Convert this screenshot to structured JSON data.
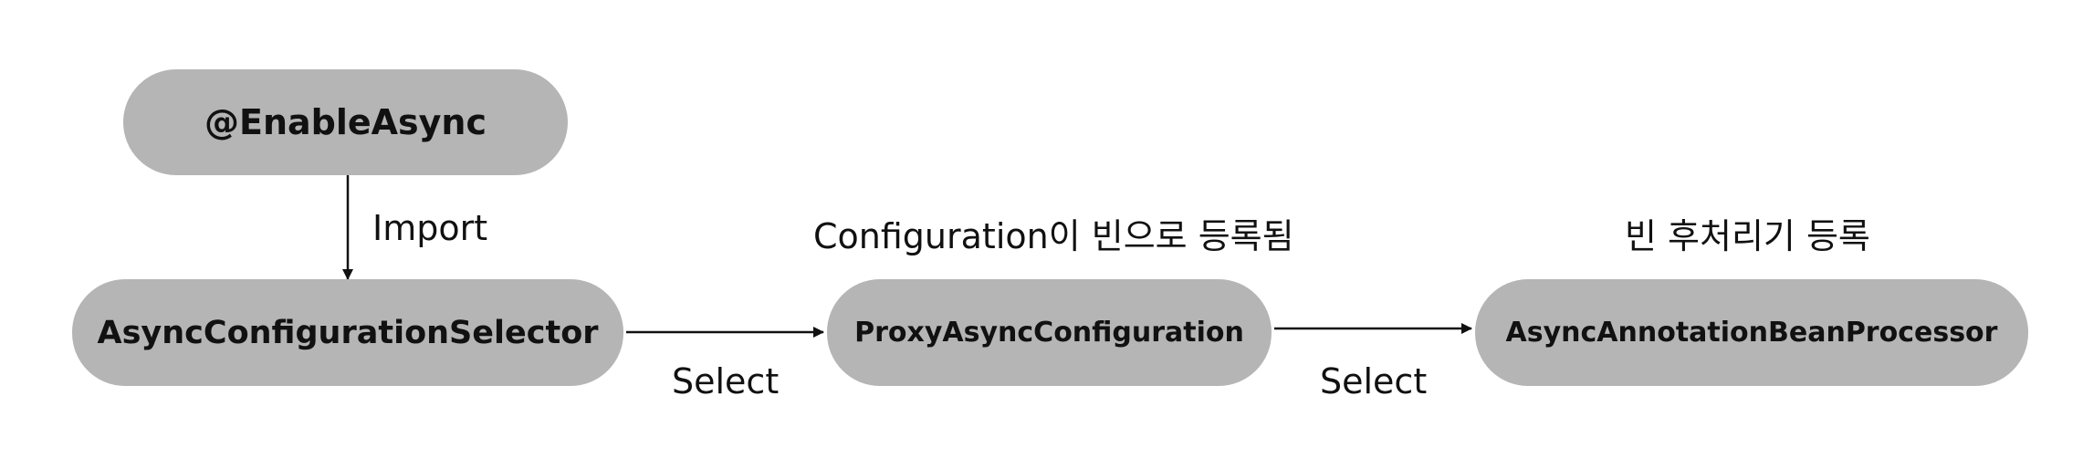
{
  "nodes": {
    "enable_async": "@EnableAsync",
    "selector": "AsyncConfigurationSelector",
    "proxy_config": "ProxyAsyncConfiguration",
    "processor": "AsyncAnnotationBeanProcessor"
  },
  "edges": {
    "import": "Import",
    "select_1": "Select",
    "select_2": "Select"
  },
  "annotations": {
    "config_registered": "Configuration이 빈으로 등록됨",
    "post_processor_registered": "빈 후처리기 등록"
  },
  "colors": {
    "node_fill": "#b5b5b5",
    "text": "#111111",
    "arrow": "#111111",
    "background": "#ffffff"
  }
}
